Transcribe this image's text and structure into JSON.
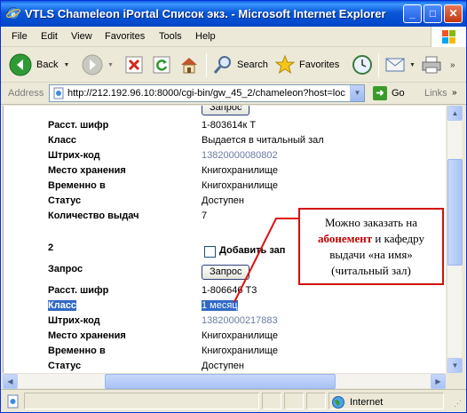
{
  "window": {
    "title": "VTLS Chameleon iPortal Список экз. - Microsoft Internet Explorer",
    "minimize": "_",
    "maximize": "□",
    "close": "✕"
  },
  "menu": [
    "File",
    "Edit",
    "View",
    "Favorites",
    "Tools",
    "Help"
  ],
  "toolbar": {
    "back": "Back",
    "search": "Search",
    "favorites": "Favorites"
  },
  "address": {
    "label": "Address",
    "url": "http://212.192.96.10:8000/cgi-bin/gw_45_2/chameleon?host=loc",
    "go": "Go",
    "links": "Links"
  },
  "record1": {
    "request_button": "Запрос",
    "rows": [
      {
        "label": "Расст. шифр",
        "value": "1-803614к Т"
      },
      {
        "label": "Класс",
        "value": "Выдается в читальный зал"
      },
      {
        "label": "Штрих-код",
        "value": "13820000080802"
      },
      {
        "label": "Место хранения",
        "value": "Книгохранилище"
      },
      {
        "label": "Временно в",
        "value": "Книгохранилище"
      },
      {
        "label": "Статус",
        "value": "Доступен"
      },
      {
        "label": "Количество выдач",
        "value": "7"
      }
    ]
  },
  "record2": {
    "number": "2",
    "add_label": "Добавить зап",
    "request_label": "Запрос",
    "request_button": "Запрос",
    "rows": [
      {
        "label": "Расст. шифр",
        "value": "1-806646 Т3"
      },
      {
        "label": "Класс",
        "value": "1 месяц"
      },
      {
        "label": "Штрих-код",
        "value": "13820000217883"
      },
      {
        "label": "Место хранения",
        "value": "Книгохранилище"
      },
      {
        "label": "Временно в",
        "value": "Книгохранилище"
      },
      {
        "label": "Статус",
        "value": "Доступен"
      }
    ]
  },
  "callout": {
    "line1": "Можно заказать на",
    "highlight": "абонемент",
    "line2_rest": " и кафедру",
    "line3": "выдачи «на имя»",
    "line4": "(читальный зал)"
  },
  "status": {
    "zone": "Internet"
  },
  "colors": {
    "titlebar": "#0858d8",
    "callout_border": "#d01010",
    "highlight": "#c00000",
    "selection": "#316ac5"
  }
}
